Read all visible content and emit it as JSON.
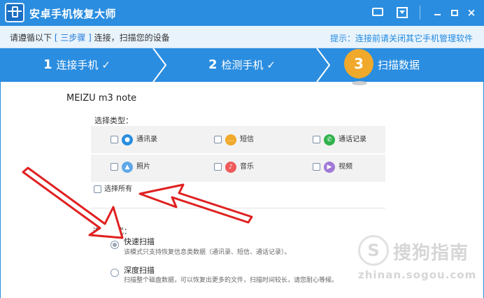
{
  "titlebar": {
    "title": "安卓手机恢复大师",
    "icons": [
      "app-logo-icon",
      "message-icon",
      "download-icon",
      "minimize-icon",
      "maximize-icon",
      "close-icon"
    ],
    "close_glyph": "×"
  },
  "infobar": {
    "instruction_prefix": "请遵循以下",
    "instruction_highlight": "[ 三步骤 ]",
    "instruction_suffix": "连接，扫描您的设备",
    "tip": "提示：连接前请关闭其它手机管理软件"
  },
  "steps": [
    {
      "number": "1",
      "label": "连接手机",
      "check": "✓"
    },
    {
      "number": "2",
      "label": "检测手机",
      "check": "✓"
    },
    {
      "number": "3",
      "label": "扫描数据"
    }
  ],
  "device": {
    "name": "MEIZU m3 note"
  },
  "types": {
    "label": "选择类型：",
    "items": [
      {
        "label": "通讯录",
        "icon": "contacts-icon",
        "color": "#2a8de0",
        "glyph": "●"
      },
      {
        "label": "短信",
        "icon": "sms-icon",
        "color": "#f0a92b",
        "glyph": "…"
      },
      {
        "label": "通话记录",
        "icon": "call-log-icon",
        "color": "#2fb24a",
        "glyph": "✆"
      },
      {
        "label": "照片",
        "icon": "photo-icon",
        "color": "#5fa8e8",
        "glyph": "▲"
      },
      {
        "label": "音乐",
        "icon": "music-icon",
        "color": "#ef5b5b",
        "glyph": "♪"
      },
      {
        "label": "视频",
        "icon": "video-icon",
        "color": "#a079d6",
        "glyph": "▶"
      }
    ],
    "select_all": "选择所有"
  },
  "mode": {
    "label": "选择模式：",
    "options": [
      {
        "title": "快速扫描",
        "desc": "该模式只支持恢复信息类数据（通讯录、短信、通话记录）。",
        "selected": true
      },
      {
        "title": "深度扫描",
        "desc": "扫描整个磁盘数据，可以恢复出更多的文件，扫描时间较长，请您耐心等候。",
        "selected": false
      }
    ]
  },
  "watermark": {
    "brand": "搜狗指南",
    "url": "zhinan.sogou.com",
    "logo_glyph": "S"
  },
  "colors": {
    "primary": "#2a8de0",
    "badge": "#f0a92b",
    "arrow": "#e02020"
  }
}
